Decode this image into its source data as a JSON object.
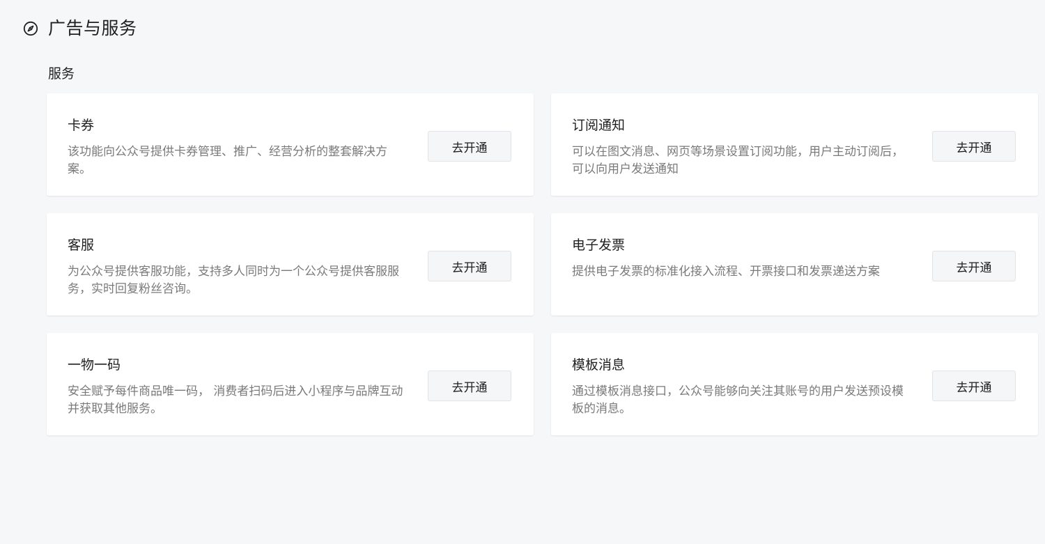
{
  "header": {
    "icon": "compass-icon",
    "title": "广告与服务"
  },
  "section": {
    "label": "服务"
  },
  "cards": [
    {
      "name": "卡券",
      "desc": "该功能向公众号提供卡券管理、推广、经营分析的整套解决方案。",
      "button": "去开通"
    },
    {
      "name": "订阅通知",
      "desc": "可以在图文消息、网页等场景设置订阅功能，用户主动订阅后，可以向用户发送通知",
      "button": "去开通"
    },
    {
      "name": "客服",
      "desc": "为公众号提供客服功能，支持多人同时为一个公众号提供客服服务，实时回复粉丝咨询。",
      "button": "去开通"
    },
    {
      "name": "电子发票",
      "desc": "提供电子发票的标准化接入流程、开票接口和发票递送方案",
      "button": "去开通"
    },
    {
      "name": "一物一码",
      "desc": "安全赋予每件商品唯一码， 消费者扫码后进入小程序与品牌互动并获取其他服务。",
      "button": "去开通"
    },
    {
      "name": "模板消息",
      "desc": "通过模板消息接口，公众号能够向关注其账号的用户发送预设模板的消息。",
      "button": "去开通"
    }
  ]
}
